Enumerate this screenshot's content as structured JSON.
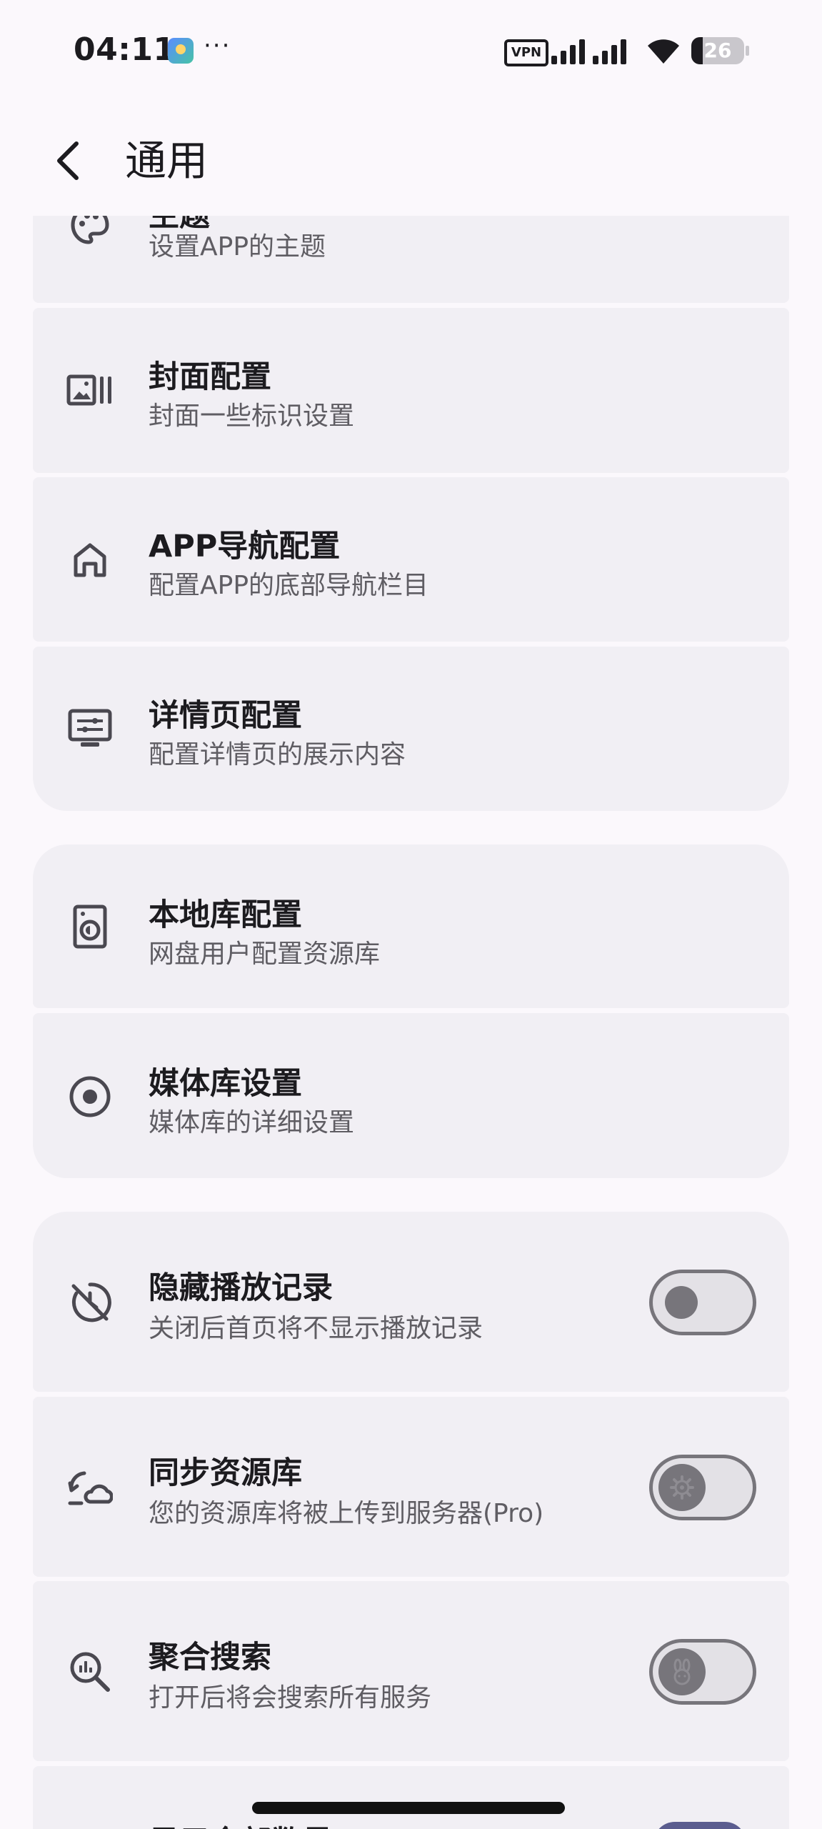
{
  "status_bar": {
    "time": "04:11",
    "more": "···",
    "vpn": "VPN",
    "battery": "26"
  },
  "header": {
    "title": "通用"
  },
  "settings": {
    "theme": {
      "title": "主题",
      "subtitle": "设置APP的主题",
      "icon": "palette-icon"
    },
    "cover": {
      "title": "封面配置",
      "subtitle": "封面一些标识设置",
      "icon": "cover-gallery-icon"
    },
    "nav": {
      "title": "APP导航配置",
      "subtitle": "配置APP的底部导航栏目",
      "icon": "home-icon"
    },
    "detail": {
      "title": "详情页配置",
      "subtitle": "配置详情页的展示内容",
      "icon": "display-settings-icon"
    },
    "local_lib": {
      "title": "本地库配置",
      "subtitle": "网盘用户配置资源库",
      "icon": "storage-device-icon"
    },
    "media_lib": {
      "title": "媒体库设置",
      "subtitle": "媒体库的详细设置",
      "icon": "disc-icon"
    },
    "hide_history": {
      "title": "隐藏播放记录",
      "subtitle": "关闭后首页将不显示播放记录",
      "icon": "history-hidden-icon",
      "enabled": false
    },
    "sync_lib": {
      "title": "同步资源库",
      "subtitle": "您的资源库将被上传到服务器(Pro)",
      "icon": "cloud-sync-icon",
      "enabled": false
    },
    "aggregate_search": {
      "title": "聚合搜索",
      "subtitle": "打开后将会搜索所有服务",
      "icon": "search-insights-icon",
      "enabled": false
    },
    "show_all": {
      "title": "显示全部数量",
      "icon": "count-icon",
      "enabled": true
    }
  },
  "colors": {
    "background": "#fbf8fc",
    "card": "#f1eff4",
    "switch_off": "#77757b",
    "switch_on": "#5b5d8f"
  }
}
